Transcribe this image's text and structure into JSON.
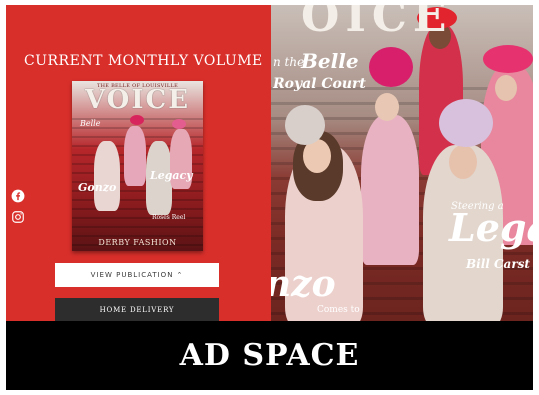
{
  "panel": {
    "heading": "CURRENT MONTHLY VOLUME",
    "view_button": "VIEW PUBLICATION",
    "view_button_chevron": "⌃",
    "home_button": "HOME DELIVERY"
  },
  "cover": {
    "kicker": "THE BELLE OF LOUISVILLE",
    "masthead": "VOICE",
    "line1": "Belle",
    "line2": "Legacy",
    "line3": "Gonzo",
    "line4": "Roses Reel",
    "line5": "DERBY FASHION"
  },
  "hero": {
    "masthead": "OICE",
    "belle_prefix": "n the",
    "belle": "Belle",
    "royal": "Royal Court",
    "steering": "Steering a",
    "legacy": "Lega",
    "bill": "Bill Carst",
    "gonzo": "nzo",
    "comes": "Comes to"
  },
  "ad": {
    "label": "AD SPACE"
  },
  "icons": [
    "facebook-icon",
    "instagram-icon"
  ],
  "colors": {
    "panel_red": "#d92f2b",
    "button_dark": "#2d2d2d",
    "ad_black": "#000000"
  }
}
